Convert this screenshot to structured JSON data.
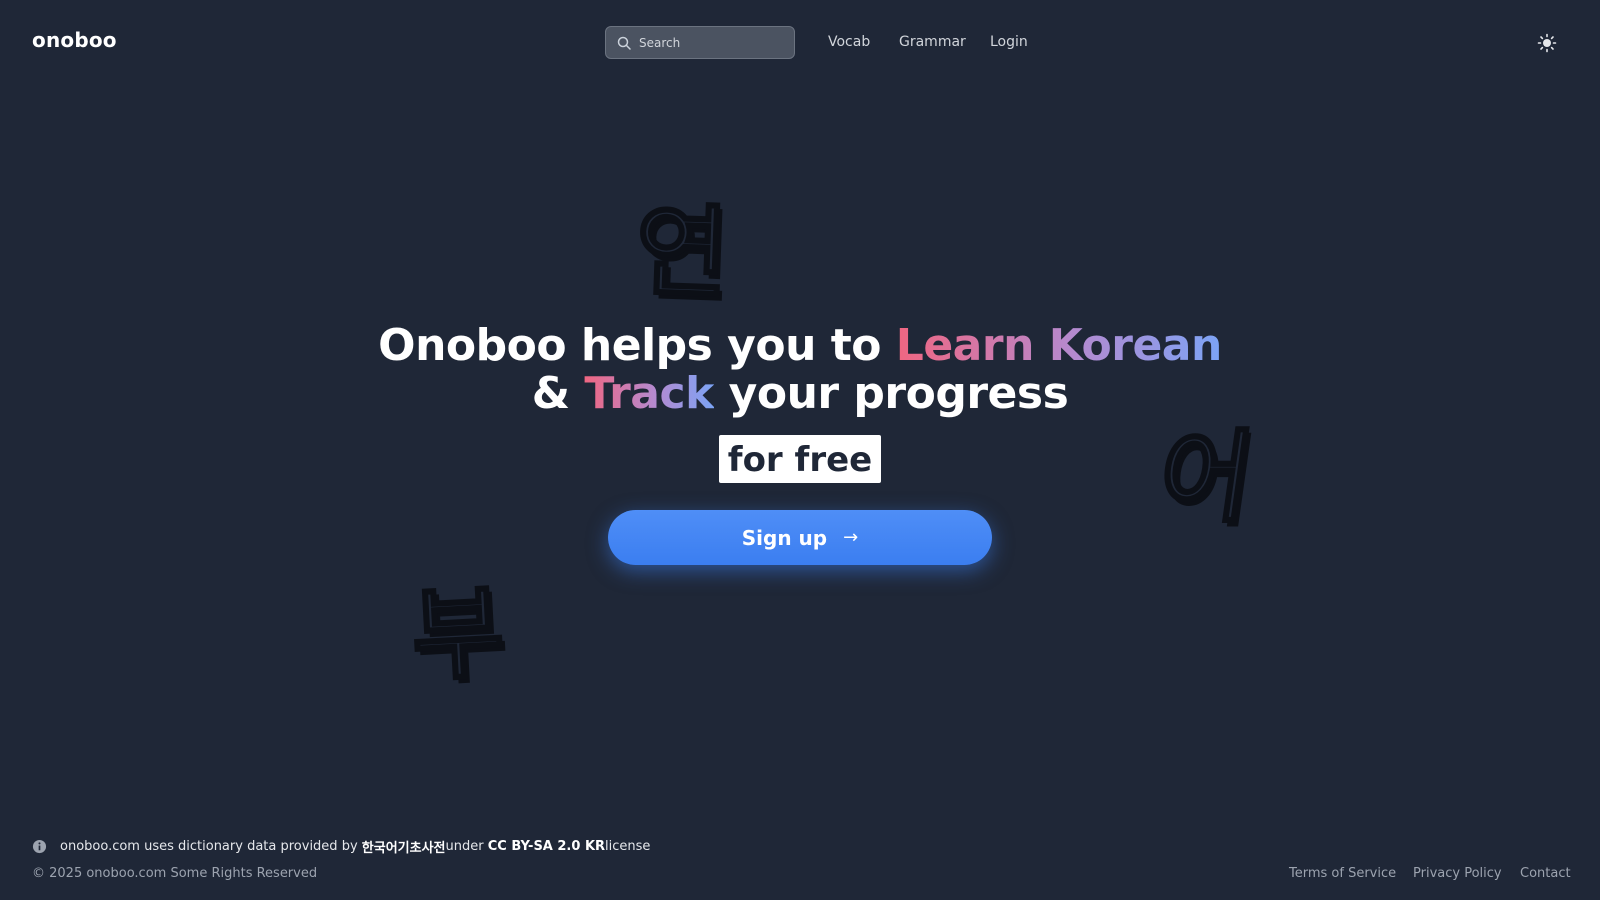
{
  "header": {
    "logo": "onoboo",
    "search": {
      "placeholder": "Search",
      "icon": "search-icon"
    },
    "nav": [
      "Vocab",
      "Grammar",
      "Login"
    ],
    "theme_toggle_icon": "sun-icon"
  },
  "decor": {
    "glyphs": [
      "연",
      "어",
      "부"
    ]
  },
  "hero": {
    "line1_prefix": "Onoboo helps you to ",
    "line1_highlight": "Learn Korean",
    "line2_prefix": "& ",
    "line2_highlight": "Track",
    "line2_suffix": " your progress",
    "badge": "for free",
    "cta_label": "Sign up",
    "cta_arrow": "→"
  },
  "footer": {
    "notice_prefix": "onoboo.com uses dictionary data provided by ",
    "notice_source": "한국어기초사전",
    "notice_middle": " under ",
    "notice_license": "CC BY-SA 2.0 KR",
    "notice_suffix": " license",
    "copyright": "© 2025  onoboo.com Some Rights Reserved",
    "links": [
      "Terms of Service",
      "Privacy Policy",
      "Contact"
    ]
  },
  "colors": {
    "background": "#1f2737",
    "accent_blue": "#3b82f6",
    "gradient_pink": "#f06681",
    "gradient_purple": "#b48ad0",
    "gradient_blue": "#7ca4f6"
  }
}
